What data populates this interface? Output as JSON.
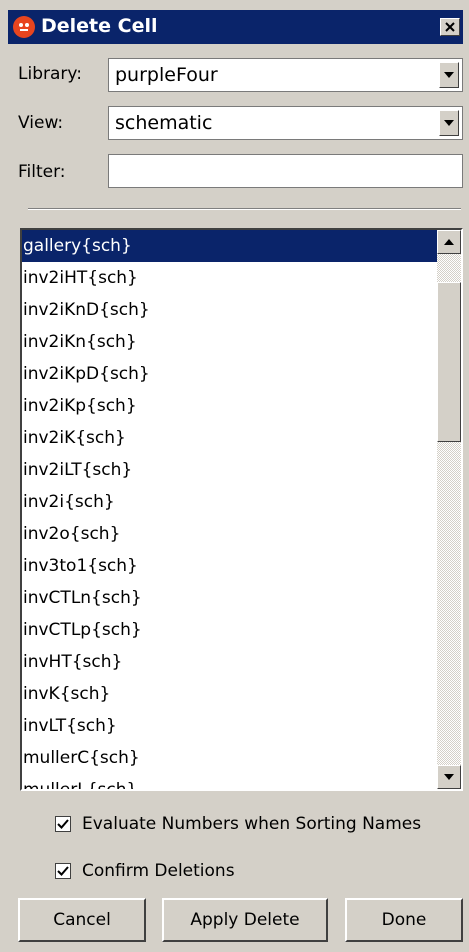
{
  "window": {
    "title": "Delete Cell",
    "close_label": "✕"
  },
  "library": {
    "label": "Library:",
    "value": "purpleFour"
  },
  "view": {
    "label": "View:",
    "value": "schematic"
  },
  "filter": {
    "label": "Filter:",
    "value": "",
    "placeholder": ""
  },
  "cells": [
    "gallery{sch}",
    "inv2iHT{sch}",
    "inv2iKnD{sch}",
    "inv2iKn{sch}",
    "inv2iKpD{sch}",
    "inv2iKp{sch}",
    "inv2iK{sch}",
    "inv2iLT{sch}",
    "inv2i{sch}",
    "inv2o{sch}",
    "inv3to1{sch}",
    "invCTLn{sch}",
    "invCTLp{sch}",
    "invHT{sch}",
    "invK{sch}",
    "invLT{sch}",
    "mullerC{sch}",
    "mullerL{sch}"
  ],
  "selected_index": 0,
  "options": {
    "evaluate_numbers": {
      "label": "Evaluate Numbers when Sorting Names",
      "checked": true
    },
    "confirm_deletions": {
      "label": "Confirm Deletions",
      "checked": true
    }
  },
  "buttons": {
    "cancel": "Cancel",
    "apply_delete": "Apply Delete",
    "done": "Done"
  },
  "colors": {
    "title_bar": "#0a246a",
    "selection": "#0a246a",
    "dialog_bg": "#d4d0c8"
  }
}
